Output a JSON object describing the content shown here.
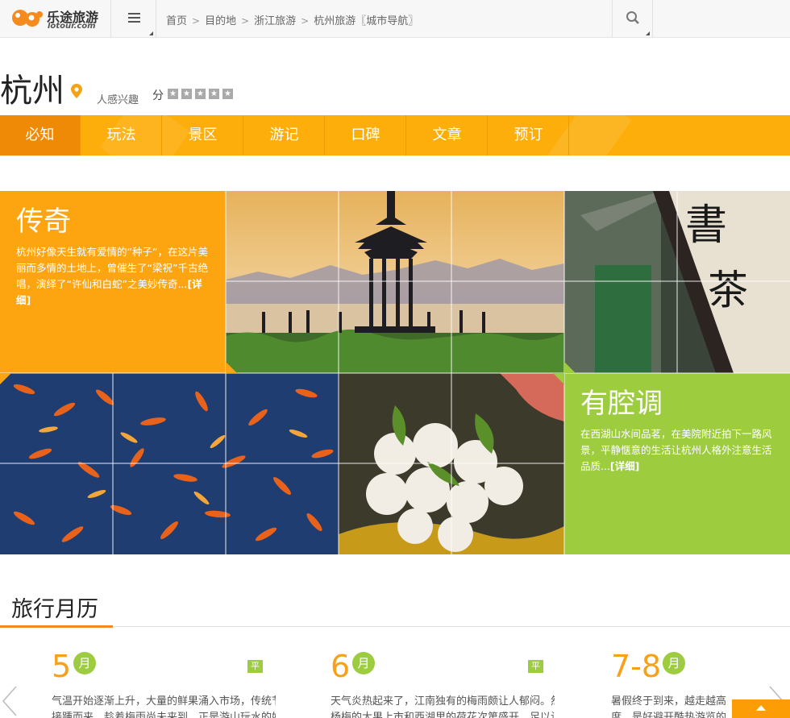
{
  "logo": {
    "cn": "乐途旅游",
    "en": "lotour.com"
  },
  "breadcrumb": [
    "首页",
    "目的地",
    "浙江旅游",
    "杭州旅游〖城市导航〗"
  ],
  "city": {
    "name": "杭州",
    "interest_text": "人感兴趣",
    "score_label": "分",
    "stars_filled": 0,
    "stars_total": 5
  },
  "nav": {
    "tabs": [
      "必知",
      "玩法",
      "景区",
      "游记",
      "口碑",
      "文章",
      "预订"
    ],
    "active": 0
  },
  "mosaic": {
    "legend": {
      "title": "传奇",
      "text": "杭州好像天生就有爱情的“种子”，在这片美丽而多情的土地上，曾催生了“梁祝”千古绝唱，演绎了“许仙和白蛇”之美妙传奇...",
      "more": "[详细]"
    },
    "tune": {
      "title": "有腔调",
      "text": "在西湖山水间品茗，在美院附近拍下一路风景，平静惬意的生活让杭州人格外注意生活品质...",
      "more": "[详细]"
    },
    "colors": {
      "orange": "#fda511",
      "green": "#9dcc3f",
      "nav": "#fdae0b"
    }
  },
  "calendar": {
    "title": "旅行月历",
    "months": [
      {
        "num": "5",
        "unit": "月",
        "season": "平季",
        "line1": "气温开始逐渐上升，大量的鲜果涌入市场，传统节日",
        "line2": "接踵而来，趁着梅雨尚未来到，正是游山玩水的好季"
      },
      {
        "num": "6",
        "unit": "月",
        "season": "平季",
        "line1": "天气炎热起来了，江南独有的梅雨颇让人郁闷。然而",
        "line2": "杨梅的大果上市和西湖里的荷花次第盛开，足以让你"
      },
      {
        "num": "7-8",
        "unit": "月",
        "season": "",
        "line1": "暑假终于到来，越走越高",
        "line2": "度，是好避开酷热游览的"
      }
    ]
  },
  "icons": [
    "menu-icon",
    "search-icon",
    "location-pin-icon",
    "star-icon",
    "arrow-left-icon",
    "arrow-right-icon",
    "back-to-top-icon"
  ]
}
